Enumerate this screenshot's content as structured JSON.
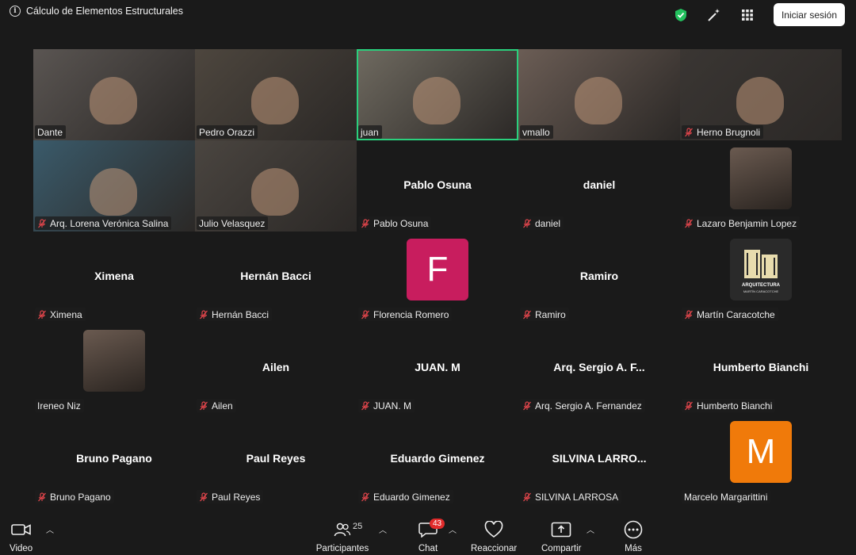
{
  "topbar": {
    "title": "Cálculo de Elementos Estructurales",
    "signin_label": "Iniciar sesión",
    "icons": [
      "info-icon",
      "shield-check-icon",
      "magic-wand-icon",
      "apps-grid-icon"
    ],
    "colors": {
      "shield": "#23c15e",
      "active_speaker": "#2ad07d"
    }
  },
  "participants": [
    {
      "name": "Dante",
      "muted": false,
      "kind": "video"
    },
    {
      "name": "Pedro Orazzi",
      "muted": false,
      "kind": "video"
    },
    {
      "name": "juan",
      "muted": false,
      "kind": "video",
      "active": true
    },
    {
      "name": "vmallo",
      "muted": false,
      "kind": "video"
    },
    {
      "name": "Herno Brugnoli",
      "muted": true,
      "kind": "video"
    },
    {
      "name": "Arq. Lorena Verónica Salina",
      "muted": true,
      "kind": "video"
    },
    {
      "name": "Julio Velasquez",
      "muted": false,
      "kind": "video"
    },
    {
      "name": "Pablo Osuna",
      "muted": true,
      "kind": "name",
      "center": "Pablo Osuna"
    },
    {
      "name": "daniel",
      "muted": true,
      "kind": "name",
      "center": "daniel"
    },
    {
      "name": "Lazaro Benjamin Lopez",
      "muted": true,
      "kind": "photo"
    },
    {
      "name": "Ximena",
      "muted": true,
      "kind": "name",
      "center": "Ximena"
    },
    {
      "name": "Hernán Bacci",
      "muted": true,
      "kind": "name",
      "center": "Hernán Bacci"
    },
    {
      "name": "Florencia Romero",
      "muted": true,
      "kind": "letter",
      "letter": "F",
      "color": "#c81d5e"
    },
    {
      "name": "Ramiro",
      "muted": true,
      "kind": "name",
      "center": "Ramiro"
    },
    {
      "name": "Martín Caracotche",
      "muted": true,
      "kind": "logo"
    },
    {
      "name": "Ireneo Niz",
      "muted": false,
      "kind": "photo"
    },
    {
      "name": "Ailen",
      "muted": true,
      "kind": "name",
      "center": "Ailen"
    },
    {
      "name": "JUAN. M",
      "muted": true,
      "kind": "name",
      "center": "JUAN. M"
    },
    {
      "name": "Arq. Sergio A. Fernandez",
      "muted": true,
      "kind": "name",
      "center": "Arq. Sergio A. F..."
    },
    {
      "name": "Humberto Bianchi",
      "muted": true,
      "kind": "name",
      "center": "Humberto Bianchi"
    },
    {
      "name": "Bruno Pagano",
      "muted": true,
      "kind": "name",
      "center": "Bruno Pagano"
    },
    {
      "name": "Paul Reyes",
      "muted": true,
      "kind": "name",
      "center": "Paul Reyes"
    },
    {
      "name": "Eduardo Gimenez",
      "muted": true,
      "kind": "name",
      "center": "Eduardo Gimenez"
    },
    {
      "name": "SILVINA LARROSA",
      "muted": true,
      "kind": "name",
      "center": "SILVINA  LARRO..."
    },
    {
      "name": "Marcelo Margarittini",
      "muted": false,
      "kind": "letter",
      "letter": "M",
      "color": "#f07a0a"
    }
  ],
  "logo_text": {
    "line1": "ARQUITECTURA",
    "line2": "MARTÍN CARACOTCHE"
  },
  "toolbar": {
    "video_label": "Video",
    "participants_label": "Participantes",
    "participants_count": "25",
    "chat_label": "Chat",
    "chat_badge": "43",
    "react_label": "Reaccionar",
    "share_label": "Compartir",
    "more_label": "Más",
    "share_color": "#ffffff"
  }
}
